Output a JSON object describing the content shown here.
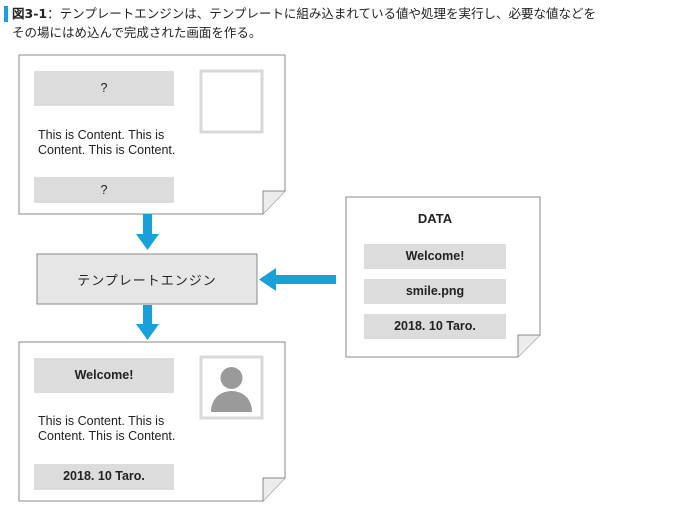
{
  "caption": {
    "figure_label": "図3-1",
    "separator": "：",
    "line1": "テンプレートエンジンは、テンプレートに組み込まれている値や処理を実行し、必要な値などを",
    "line2": "その場にはめ込んで完成された画面を作る。"
  },
  "template_doc": {
    "header_placeholder": "?",
    "content": "This is Content. This is\nContent. This is Content.",
    "footer_placeholder": "?"
  },
  "engine": {
    "label": "テンプレートエンジン"
  },
  "data_doc": {
    "title": "DATA",
    "items": [
      "Welcome!",
      "smile.png",
      "2018. 10 Taro."
    ]
  },
  "output_doc": {
    "header": "Welcome!",
    "content": "This is Content. This is\nContent. This is Content.",
    "footer": "2018. 10 Taro."
  },
  "colors": {
    "arrow": "#1aa0d8",
    "gray_box": "#dcdcdc",
    "engine_box": "#e6e6e6",
    "border": "#8a8a8a",
    "avatar": "#9a9a9a"
  }
}
